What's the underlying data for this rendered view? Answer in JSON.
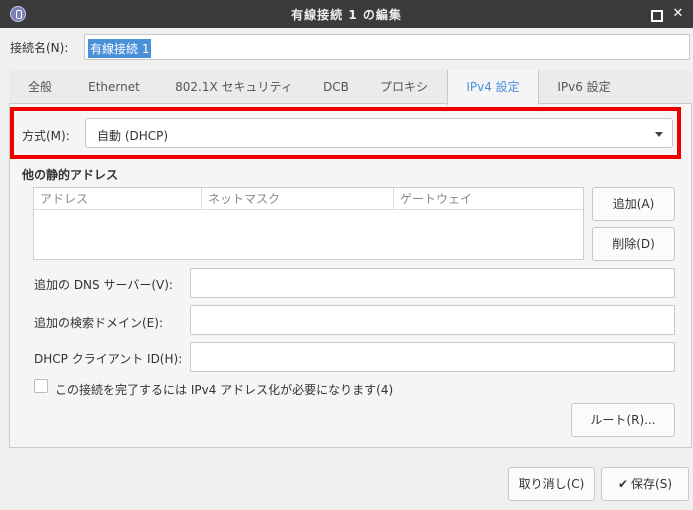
{
  "window": {
    "title": "有線接続 1 の編集",
    "maximize_icon": "maximize-icon",
    "close_glyph": "✕"
  },
  "connection_name": {
    "label": "接続名(N):",
    "value": "有線接続 1"
  },
  "tabs": [
    {
      "label": "全般"
    },
    {
      "label": "Ethernet"
    },
    {
      "label": "802.1X セキュリティ"
    },
    {
      "label": "DCB"
    },
    {
      "label": "プロキシ"
    },
    {
      "label": "IPv4 設定"
    },
    {
      "label": "IPv6 設定"
    }
  ],
  "active_tab": "IPv4 設定",
  "method": {
    "label": "方式(M):",
    "value": "自動 (DHCP)"
  },
  "static_addresses": {
    "heading": "他の静的アドレス",
    "columns": [
      "アドレス",
      "ネットマスク",
      "ゲートウェイ"
    ],
    "add_label": "追加(A)",
    "delete_label": "削除(D)"
  },
  "fields": {
    "dns_label": "追加の DNS サーバー(V):",
    "search_label": "追加の検索ドメイン(E):",
    "dhcp_label": "DHCP クライアント ID(H):"
  },
  "require_ipv4": {
    "label": "この接続を完了するには IPv4 アドレス化が必要になります(4)",
    "checked": false
  },
  "route_label": "ルート(R)...",
  "buttons": {
    "cancel_label": "取り消し(C)",
    "save_label": "保存(S)",
    "save_check": "✔"
  },
  "colors": {
    "accent": "#4a90d9",
    "highlight_box": "#ee0000",
    "titlebar": "#3b3b3b"
  }
}
